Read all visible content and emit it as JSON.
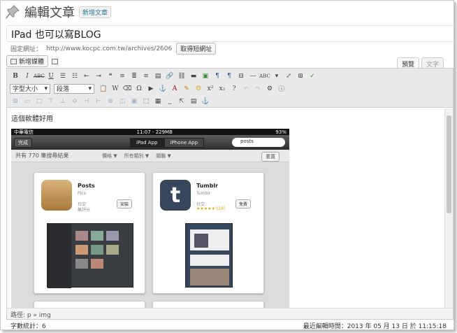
{
  "header": {
    "title": "編輯文章",
    "add_new": "新增文章"
  },
  "post": {
    "title": "IPad 也可以寫BLOG"
  },
  "permalink": {
    "label": "固定網址：",
    "url": "http://www.kocpc.com.tw/archives/2606",
    "button": "取得短網址"
  },
  "media": {
    "button": "新增媒體"
  },
  "editor_tabs": [
    "預覽",
    "文字"
  ],
  "toolbar": {
    "font_size": "字型大小",
    "format": "段落"
  },
  "content": {
    "text": "這個軟體好用"
  },
  "ipad": {
    "carrier": "中華電信",
    "time": "11:07 - 229MB",
    "battery": "93%",
    "back": "完成",
    "seg": [
      "iPad App",
      "iPhone App"
    ],
    "search": "posts",
    "results": "共有 770 筆搜尋結果",
    "filters": [
      "價格 ▼",
      "所有類別 ▼",
      "關聯 ▼"
    ],
    "reset": "重置",
    "apps": [
      {
        "name": "Posts",
        "dev": "Pico",
        "cat": "社交",
        "cat2": "無評分",
        "price": "安裝"
      },
      {
        "name": "Tumblr",
        "dev": "Tumblr",
        "cat": "社交",
        "cat2": "★★★★★ (19)",
        "price": "免費"
      }
    ]
  },
  "pathbar": {
    "text": "路徑: p » img"
  },
  "footer": {
    "wordcount": "字數統計：6",
    "last_edit": "最近編輯時間：2013 年 05 月 13 日 於 11:15:18"
  }
}
